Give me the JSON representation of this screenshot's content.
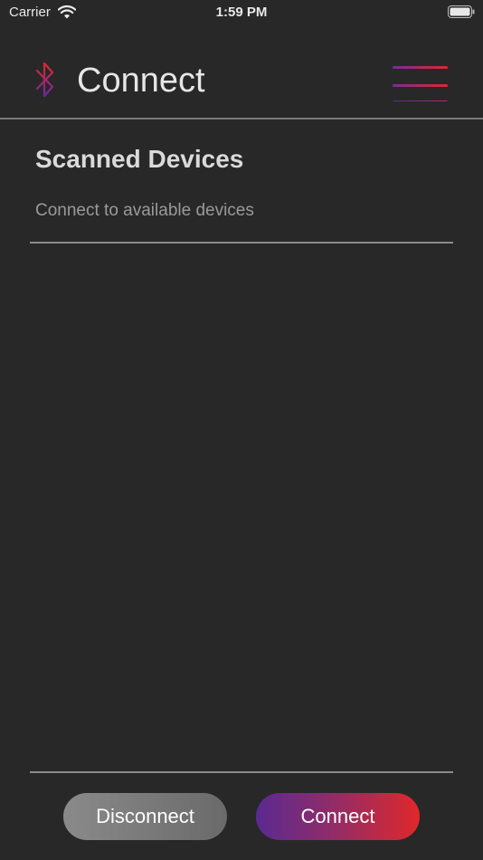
{
  "status_bar": {
    "carrier": "Carrier",
    "time": "1:59 PM",
    "icons": [
      "wifi-icon",
      "battery-icon"
    ]
  },
  "header": {
    "title": "Connect",
    "logo_icon": "bluetooth-icon",
    "menu_icon": "hamburger-menu-icon"
  },
  "section": {
    "title": "Scanned Devices",
    "subtitle": "Connect to available devices",
    "devices": []
  },
  "actions": {
    "disconnect_label": "Disconnect",
    "connect_label": "Connect"
  },
  "colors": {
    "background": "#282828",
    "accent_purple": "#5a2a90",
    "accent_red": "#e0282a",
    "disconnect_gray": "#7a7a7a"
  }
}
